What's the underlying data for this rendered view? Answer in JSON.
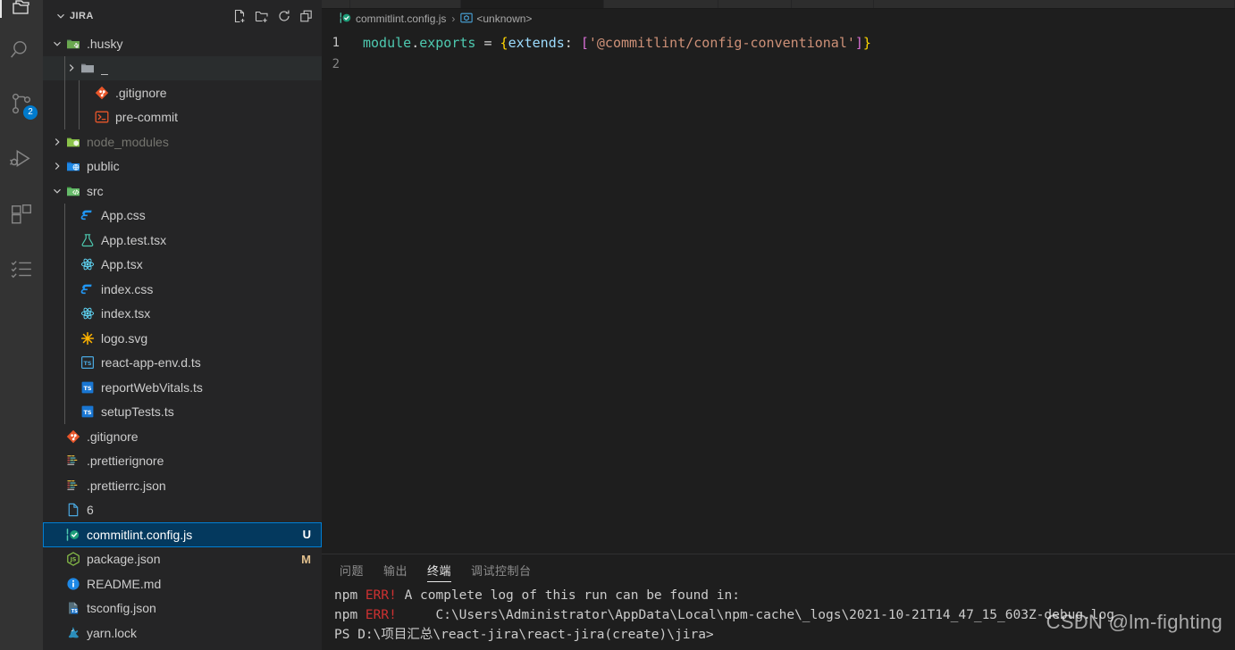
{
  "activity_bar": {
    "items": [
      {
        "name": "explorer",
        "icon": "files-icon",
        "active": true,
        "badge": ""
      },
      {
        "name": "search",
        "icon": "search-icon",
        "active": false,
        "badge": ""
      },
      {
        "name": "source-control",
        "icon": "source-control-icon",
        "active": false,
        "badge": "2"
      },
      {
        "name": "run-and-debug",
        "icon": "run-debug-icon",
        "active": false,
        "badge": ""
      },
      {
        "name": "extensions",
        "icon": "extensions-icon",
        "active": false,
        "badge": ""
      },
      {
        "name": "testing",
        "icon": "checklist-icon",
        "active": false,
        "badge": ""
      }
    ]
  },
  "sidebar": {
    "title": "JIRA",
    "actions": [
      {
        "name": "new-file",
        "icon": "new-file-icon",
        "tooltip": "New File"
      },
      {
        "name": "new-folder",
        "icon": "new-folder-icon",
        "tooltip": "New Folder"
      },
      {
        "name": "refresh",
        "icon": "refresh-icon",
        "tooltip": "Refresh Explorer"
      },
      {
        "name": "collapse-all",
        "icon": "collapse-all-icon",
        "tooltip": "Collapse Folders in Explorer"
      }
    ],
    "tree": [
      {
        "label": ".husky",
        "depth": 1,
        "type": "folder",
        "expanded": true,
        "icon": "folder-husky",
        "state": "normal",
        "badge": ""
      },
      {
        "label": "_",
        "depth": 2,
        "type": "folder",
        "expanded": false,
        "icon": "folder-plain",
        "state": "hover",
        "badge": ""
      },
      {
        "label": ".gitignore",
        "depth": 3,
        "type": "file",
        "expanded": null,
        "icon": "git-icon",
        "state": "normal",
        "badge": ""
      },
      {
        "label": "pre-commit",
        "depth": 3,
        "type": "file",
        "expanded": null,
        "icon": "console-icon",
        "state": "normal",
        "badge": ""
      },
      {
        "label": "node_modules",
        "depth": 1,
        "type": "folder",
        "expanded": false,
        "icon": "folder-node",
        "state": "dim",
        "badge": ""
      },
      {
        "label": "public",
        "depth": 1,
        "type": "folder",
        "expanded": false,
        "icon": "folder-public",
        "state": "normal",
        "badge": ""
      },
      {
        "label": "src",
        "depth": 1,
        "type": "folder",
        "expanded": true,
        "icon": "folder-src",
        "state": "normal",
        "badge": ""
      },
      {
        "label": "App.css",
        "depth": 2,
        "type": "file",
        "expanded": null,
        "icon": "css-icon",
        "state": "normal",
        "badge": ""
      },
      {
        "label": "App.test.tsx",
        "depth": 2,
        "type": "file",
        "expanded": null,
        "icon": "test-icon",
        "state": "normal",
        "badge": ""
      },
      {
        "label": "App.tsx",
        "depth": 2,
        "type": "file",
        "expanded": null,
        "icon": "react-icon",
        "state": "normal",
        "badge": ""
      },
      {
        "label": "index.css",
        "depth": 2,
        "type": "file",
        "expanded": null,
        "icon": "css-icon",
        "state": "normal",
        "badge": ""
      },
      {
        "label": "index.tsx",
        "depth": 2,
        "type": "file",
        "expanded": null,
        "icon": "react-icon",
        "state": "normal",
        "badge": ""
      },
      {
        "label": "logo.svg",
        "depth": 2,
        "type": "file",
        "expanded": null,
        "icon": "svg-icon",
        "state": "normal",
        "badge": ""
      },
      {
        "label": "react-app-env.d.ts",
        "depth": 2,
        "type": "file",
        "expanded": null,
        "icon": "ts-def-icon",
        "state": "normal",
        "badge": ""
      },
      {
        "label": "reportWebVitals.ts",
        "depth": 2,
        "type": "file",
        "expanded": null,
        "icon": "ts-icon",
        "state": "normal",
        "badge": ""
      },
      {
        "label": "setupTests.ts",
        "depth": 2,
        "type": "file",
        "expanded": null,
        "icon": "ts-icon",
        "state": "normal",
        "badge": ""
      },
      {
        "label": ".gitignore",
        "depth": 1,
        "type": "file",
        "expanded": null,
        "icon": "git-icon",
        "state": "normal",
        "badge": ""
      },
      {
        "label": ".prettierignore",
        "depth": 1,
        "type": "file",
        "expanded": null,
        "icon": "prettier-icon",
        "state": "normal",
        "badge": ""
      },
      {
        "label": ".prettierrc.json",
        "depth": 1,
        "type": "file",
        "expanded": null,
        "icon": "prettier-icon",
        "state": "normal",
        "badge": ""
      },
      {
        "label": "6",
        "depth": 1,
        "type": "file",
        "expanded": null,
        "icon": "blank-file-icon",
        "state": "normal",
        "badge": ""
      },
      {
        "label": "commitlint.config.js",
        "depth": 1,
        "type": "file",
        "expanded": null,
        "icon": "config-check-icon",
        "state": "selected",
        "badge": "U"
      },
      {
        "label": "package.json",
        "depth": 1,
        "type": "file",
        "expanded": null,
        "icon": "npm-icon",
        "state": "normal",
        "badge": "M"
      },
      {
        "label": "README.md",
        "depth": 1,
        "type": "file",
        "expanded": null,
        "icon": "info-icon",
        "state": "normal",
        "badge": ""
      },
      {
        "label": "tsconfig.json",
        "depth": 1,
        "type": "file",
        "expanded": null,
        "icon": "tsconfig-icon",
        "state": "normal",
        "badge": ""
      },
      {
        "label": "yarn.lock",
        "depth": 1,
        "type": "file",
        "expanded": null,
        "icon": "yarn-icon",
        "state": "normal",
        "badge": ""
      }
    ]
  },
  "editor": {
    "breadcrumb": {
      "file": "commitlint.config.js",
      "separator": "›",
      "symbol": "<unknown>"
    },
    "lines": [
      {
        "number": "1",
        "tokens": [
          {
            "text": "module",
            "color": "teal"
          },
          {
            "text": ".",
            "color": "white"
          },
          {
            "text": "exports",
            "color": "teal"
          },
          {
            "text": " ",
            "color": "white"
          },
          {
            "text": "=",
            "color": "white"
          },
          {
            "text": " ",
            "color": "white"
          },
          {
            "text": "{",
            "color": "yellow"
          },
          {
            "text": "extends",
            "color": "blue"
          },
          {
            "text": ":",
            "color": "white"
          },
          {
            "text": " ",
            "color": "white"
          },
          {
            "text": "[",
            "color": "pink"
          },
          {
            "text": "'@commitlint/config-conventional'",
            "color": "orange"
          },
          {
            "text": "]",
            "color": "pink"
          },
          {
            "text": "}",
            "color": "yellow"
          }
        ]
      },
      {
        "number": "2",
        "tokens": []
      }
    ]
  },
  "panel": {
    "tabs": [
      {
        "label": "问题",
        "name": "problems",
        "active": false
      },
      {
        "label": "输出",
        "name": "output",
        "active": false
      },
      {
        "label": "终端",
        "name": "terminal",
        "active": true
      },
      {
        "label": "调试控制台",
        "name": "debug-console",
        "active": false
      }
    ],
    "terminal_lines": [
      {
        "prefix": "npm ",
        "err": "ERR!",
        "text": " A complete log of this run can be found in:"
      },
      {
        "prefix": "npm ",
        "err": "ERR!",
        "text": "     C:\\Users\\Administrator\\AppData\\Local\\npm-cache\\_logs\\2021-10-21T14_47_15_603Z-debug.log"
      },
      {
        "prefix": "",
        "err": "",
        "text": "PS D:\\项目汇总\\react-jira\\react-jira(create)\\jira>"
      }
    ]
  },
  "watermark": {
    "text": "CSDN @lm-fighting"
  },
  "colors": {
    "accent": "#007acc",
    "selection": "#04395e",
    "selection_border": "#007fd4",
    "sidebar_bg": "#252526",
    "editor_bg": "#1e1e1e",
    "activity_bg": "#333333",
    "git_untracked": "#73c991",
    "git_modified": "#e2c08d",
    "error_red": "#cd3131"
  }
}
